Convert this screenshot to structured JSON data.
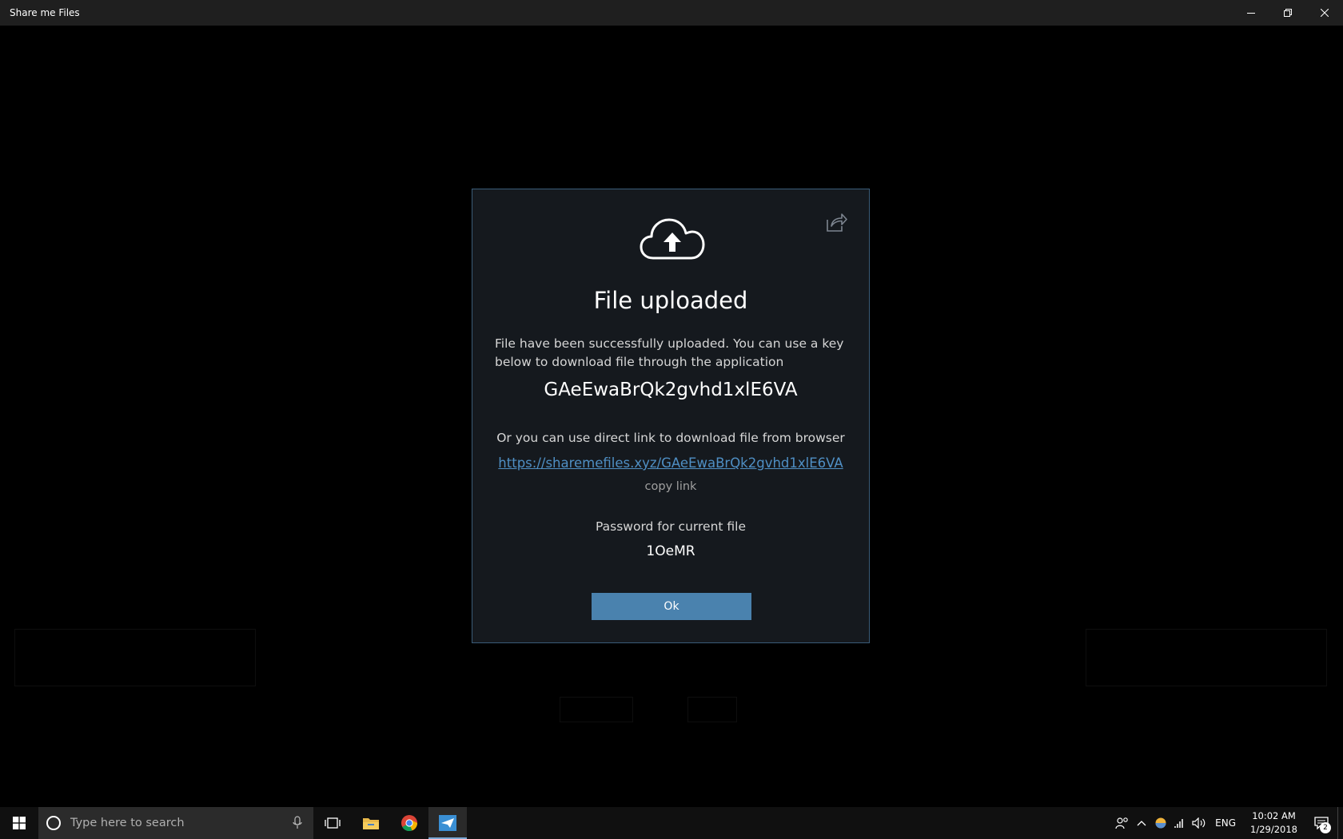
{
  "window": {
    "title": "Share me Files"
  },
  "dialog": {
    "title": "File uploaded",
    "description": "File have been successfully uploaded. You can use a key below to download file through the application",
    "key": "GAeEwaBrQk2gvhd1xlE6VA",
    "or_text": "Or you can use direct link to download file from browser",
    "link": "https://sharemefiles.xyz/GAeEwaBrQk2gvhd1xlE6VA",
    "copy_link": "copy link",
    "password_label": "Password for current file",
    "password": "1OeMR",
    "ok_label": "Ok",
    "icons": [
      "cloud-upload-icon",
      "share-icon"
    ],
    "colors": {
      "background": "#15191e",
      "border": "#3a5c78",
      "button": "#4a82ae",
      "link": "#4f8fc4"
    }
  },
  "taskbar": {
    "search_placeholder": "Type here to search",
    "apps": [
      "task-view-icon",
      "file-explorer-icon",
      "chrome-icon",
      "share-me-files-icon"
    ],
    "tray": {
      "language": "ENG",
      "time": "10:02 AM",
      "date": "1/29/2018",
      "notifications": "2"
    }
  }
}
